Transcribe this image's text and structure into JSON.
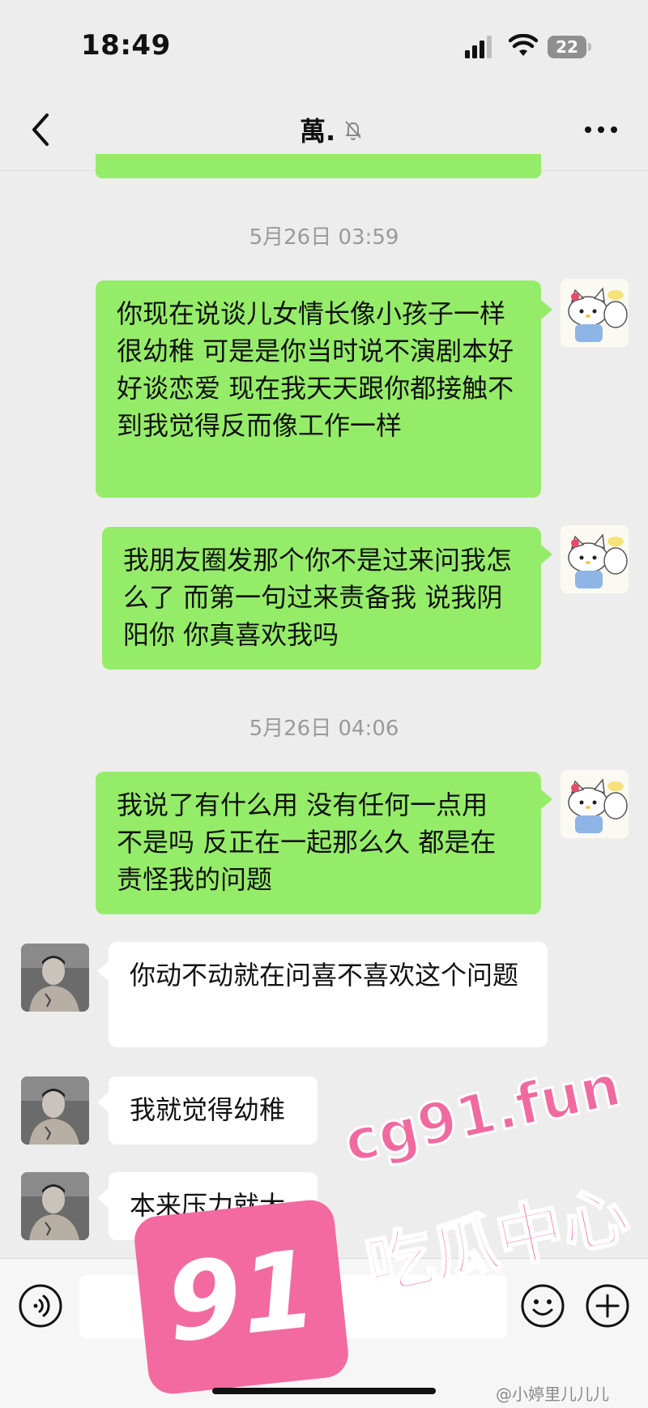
{
  "status_bar": {
    "time": "18:49",
    "battery": "22"
  },
  "nav": {
    "title": "萬."
  },
  "timestamps": [
    "5月26日 03:59",
    "5月26日 04:06"
  ],
  "messages": [
    {
      "side": "right",
      "sender": "me",
      "text": "你现在说谈儿女情长像小孩子一样很幼稚 可是是你当时说不演剧本好好谈恋爱  现在我天天跟你都接触不到我觉得反而像工作一样"
    },
    {
      "side": "right",
      "sender": "me",
      "text": "我朋友圈发那个你不是过来问我怎么了 而第一句过来责备我 说我阴阳你 你真喜欢我吗"
    },
    {
      "side": "right",
      "sender": "me",
      "text": "我说了有什么用 没有任何一点用 不是吗 反正在一起那么久 都是在责怪我的问题"
    },
    {
      "side": "left",
      "sender": "other",
      "text": "你动不动就在问喜不喜欢这个问题"
    },
    {
      "side": "left",
      "sender": "other",
      "text": "我就觉得幼稚"
    },
    {
      "side": "left",
      "sender": "other",
      "text": "本来压力就大"
    }
  ],
  "watermark": {
    "badge": "91",
    "site": "cg91.fun",
    "tagline": "吃瓜中心",
    "weibo": "@小婷里儿儿儿",
    "color": "#f06aa0"
  },
  "colors": {
    "bubble_right": "#95ec69",
    "bubble_left": "#ffffff",
    "background": "#ededed"
  }
}
